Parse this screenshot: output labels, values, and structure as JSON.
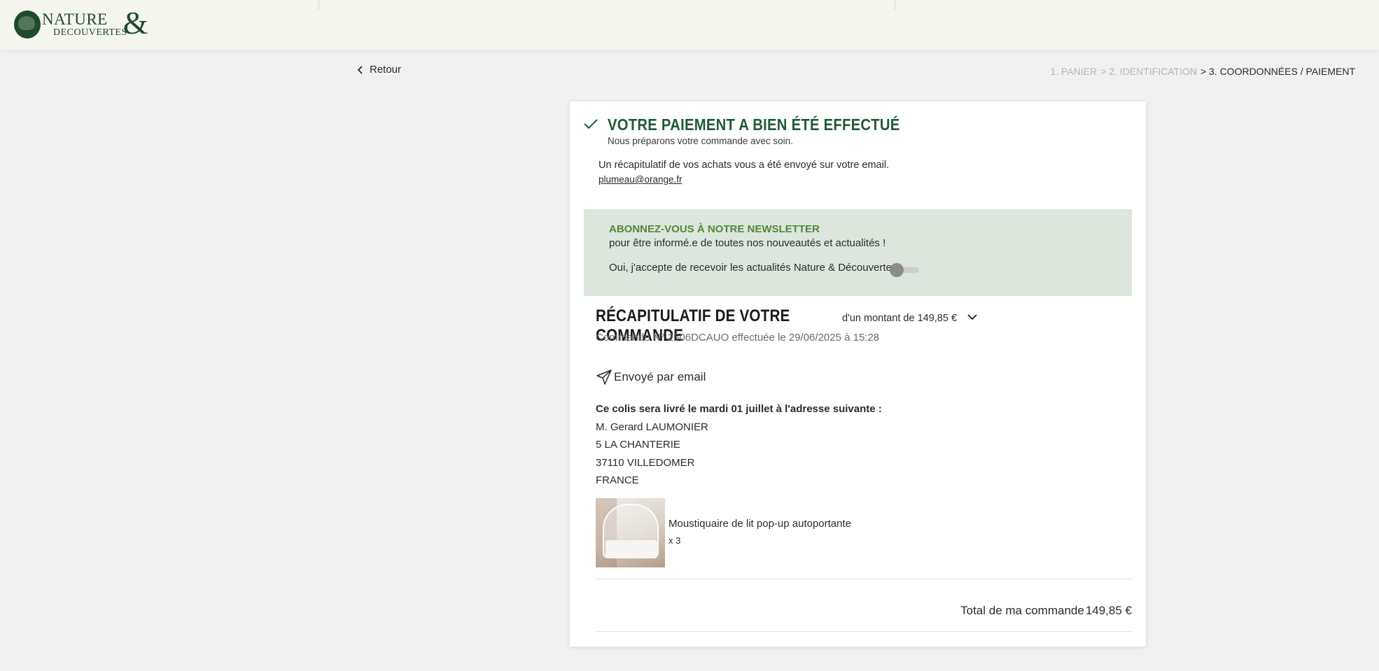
{
  "brand": {
    "logo_top": "NATURE",
    "logo_bottom": "DECOUVERTES",
    "logo_amp": "&",
    "color": "#1f4a2c"
  },
  "nav": {
    "back_label": "Retour",
    "steps": [
      {
        "label": "1. PANIER",
        "state": "done"
      },
      {
        "label": "> 2. IDENTIFICATION",
        "state": "done"
      },
      {
        "label": "> 3. COORDONNÉES / PAIEMENT",
        "state": "active"
      }
    ]
  },
  "confirmation": {
    "title": "VOTRE PAIEMENT A BIEN ÉTÉ EFFECTUÉ",
    "subtitle": "Nous préparons votre commande avec soin.",
    "recap_note": "Un récapitulatif de vos achats vous a été envoyé sur votre email.",
    "email": "plumeau@orange.fr",
    "accent": "#1f5a35"
  },
  "newsletter": {
    "title": "ABONNEZ-VOUS À NOTRE NEWSLETTER",
    "subtitle": "pour être informé.e de toutes nos nouveautés et actualités !",
    "accept_label": "Oui, j'accepte de recevoir les actualités Nature & Découvertes",
    "toggle_on": false,
    "background": "#dde6dc"
  },
  "order": {
    "title": "RÉCAPITULATIF DE VOTRE COMMANDE",
    "amount_label": "d'un montant de 149,85 €",
    "meta": "Commande N° 2506DCAUO effectuée le 29/06/2025 à 15:28",
    "sent_label": "Envoyé par email",
    "delivery_lead": "Ce colis sera livré le mardi 01 juillet à l'adresse suivante :",
    "address": {
      "name": "M. Gerard LAUMONIER",
      "line1": "5 LA CHANTERIE",
      "city": "37110 VILLEDOMER",
      "country": "FRANCE"
    },
    "items": [
      {
        "name": "Moustiquaire de lit pop-up autoportante",
        "qty": "x 3",
        "image": "mosquito-net-bed-photo"
      }
    ],
    "total_label": "Total de ma commande",
    "total_value": "149,85 €"
  }
}
